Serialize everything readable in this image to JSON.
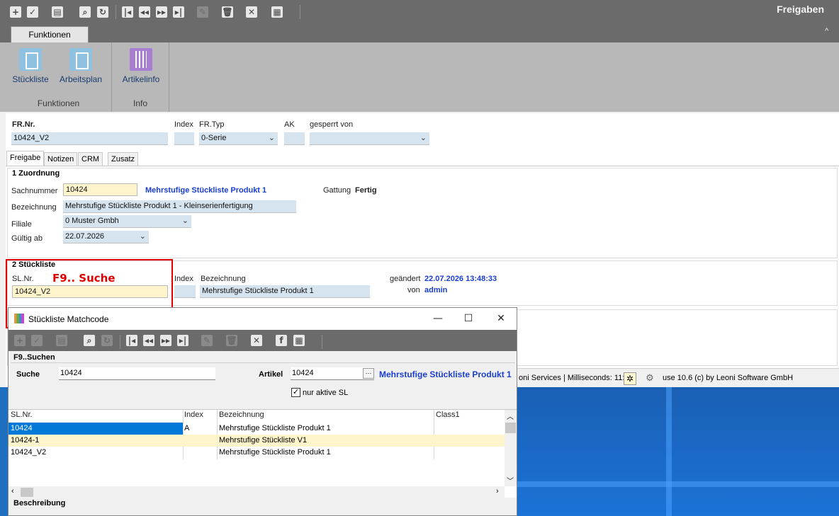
{
  "app": {
    "title": "Freigaben"
  },
  "toolbar": {
    "icons": [
      "add-icon",
      "check-icon",
      "print-icon",
      "search-icon",
      "refresh-icon",
      "first-icon",
      "prev-icon",
      "next-icon",
      "last-icon",
      "edit-icon",
      "delete-icon",
      "close-icon",
      "grid-icon"
    ]
  },
  "ribbon": {
    "tab": "Funktionen",
    "collapse": "^",
    "groups": [
      {
        "label": "Funktionen",
        "buttons": [
          "Stückliste",
          "Arbeitsplan"
        ]
      },
      {
        "label": "Info",
        "buttons": [
          "Artikelinfo"
        ]
      }
    ]
  },
  "header": {
    "fr_nr_label": "FR.Nr.",
    "fr_nr_value": "10424_V2",
    "index_label": "Index",
    "index_value": "",
    "fr_typ_label": "FR.Typ",
    "fr_typ_value": "0-Serie",
    "ak_label": "AK",
    "ak_value": "",
    "gesperrt_label": "gesperrt von",
    "gesperrt_value": ""
  },
  "tabs": [
    "Freigabe",
    "Notizen",
    "CRM",
    "Zusatz"
  ],
  "zuordnung": {
    "title": "1 Zuordnung",
    "sachnummer_label": "Sachnummer",
    "sachnummer_value": "10424",
    "sachnummer_desc": "Mehrstufige Stückliste Produkt 1",
    "gattung_label": "Gattung",
    "gattung_value": "Fertig",
    "bezeichnung_label": "Bezeichnung",
    "bezeichnung_value": "Mehrstufige Stückliste Produkt 1 - Kleinserienfertigung",
    "filiale_label": "Filiale",
    "filiale_value": "0  Muster Gmbh",
    "gueltig_label": "Gültig ab",
    "gueltig_value": "22.07.2026"
  },
  "stueckliste": {
    "title": "2 Stückliste",
    "slnr_label": "SL.Nr.",
    "slnr_value": "10424_V2",
    "index_label": "Index",
    "index_value": "",
    "bez_label": "Bezeichnung",
    "bez_value": "Mehrstufige Stückliste Produkt 1",
    "geaendert_label": "geändert",
    "geaendert_value": "22.07.2026 13:48:33",
    "von_label": "von",
    "von_value": "admin"
  },
  "annotation": {
    "f9": "F9.. Suche"
  },
  "statusbar": {
    "services": "oni Services | Milliseconds: 11:",
    "version": "use 10.6 (c) by Leoni Software GmbH"
  },
  "dialog": {
    "title": "Stückliste Matchcode",
    "minimize": "—",
    "maximize": "☐",
    "close": "✕",
    "section": "F9..Suchen",
    "suche_label": "Suche",
    "suche_value": "10424",
    "artikel_label": "Artikel",
    "artikel_value": "10424",
    "artikel_btn": "···",
    "artikel_desc": "Mehrstufige Stückliste Produkt 1",
    "checkbox_label": "nur aktive SL",
    "grid": {
      "columns": [
        "SL.Nr.",
        "Index",
        "Bezeichnung",
        "Class1"
      ],
      "rows": [
        {
          "sl": "10424",
          "index": "A",
          "bez": "Mehrstufige Stückliste Produkt 1",
          "class1": ""
        },
        {
          "sl": "10424-1",
          "index": "",
          "bez": "Mehrstufige Stückliste V1",
          "class1": ""
        },
        {
          "sl": "10424_V2",
          "index": "",
          "bez": "Mehrstufige Stückliste Produkt 1",
          "class1": ""
        }
      ]
    },
    "beschreibung": "Beschreibung"
  }
}
